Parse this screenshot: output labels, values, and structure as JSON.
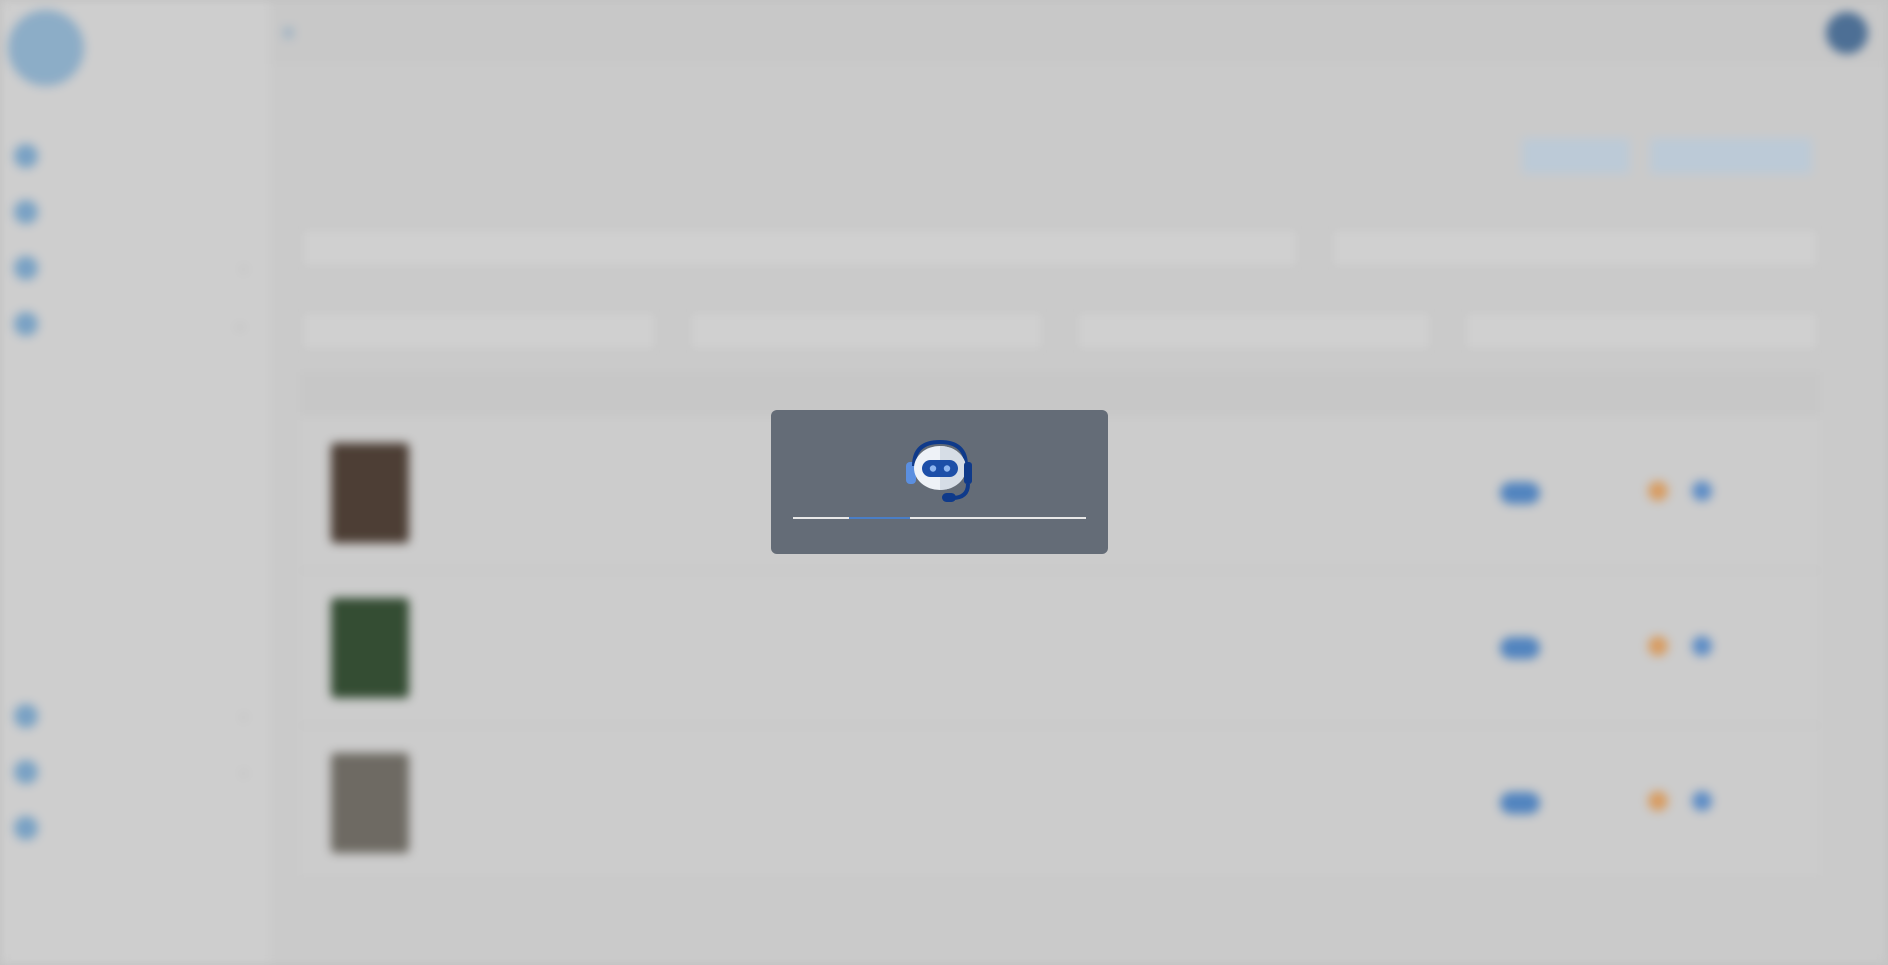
{
  "app": {
    "brand": ""
  },
  "loader": {
    "progress": 0.21,
    "progress_offset": 0.19,
    "icon": "robot-headset-icon",
    "colors": {
      "panel": "#646c77",
      "accent": "#4a7ec6",
      "track": "#e8e8e8"
    }
  }
}
